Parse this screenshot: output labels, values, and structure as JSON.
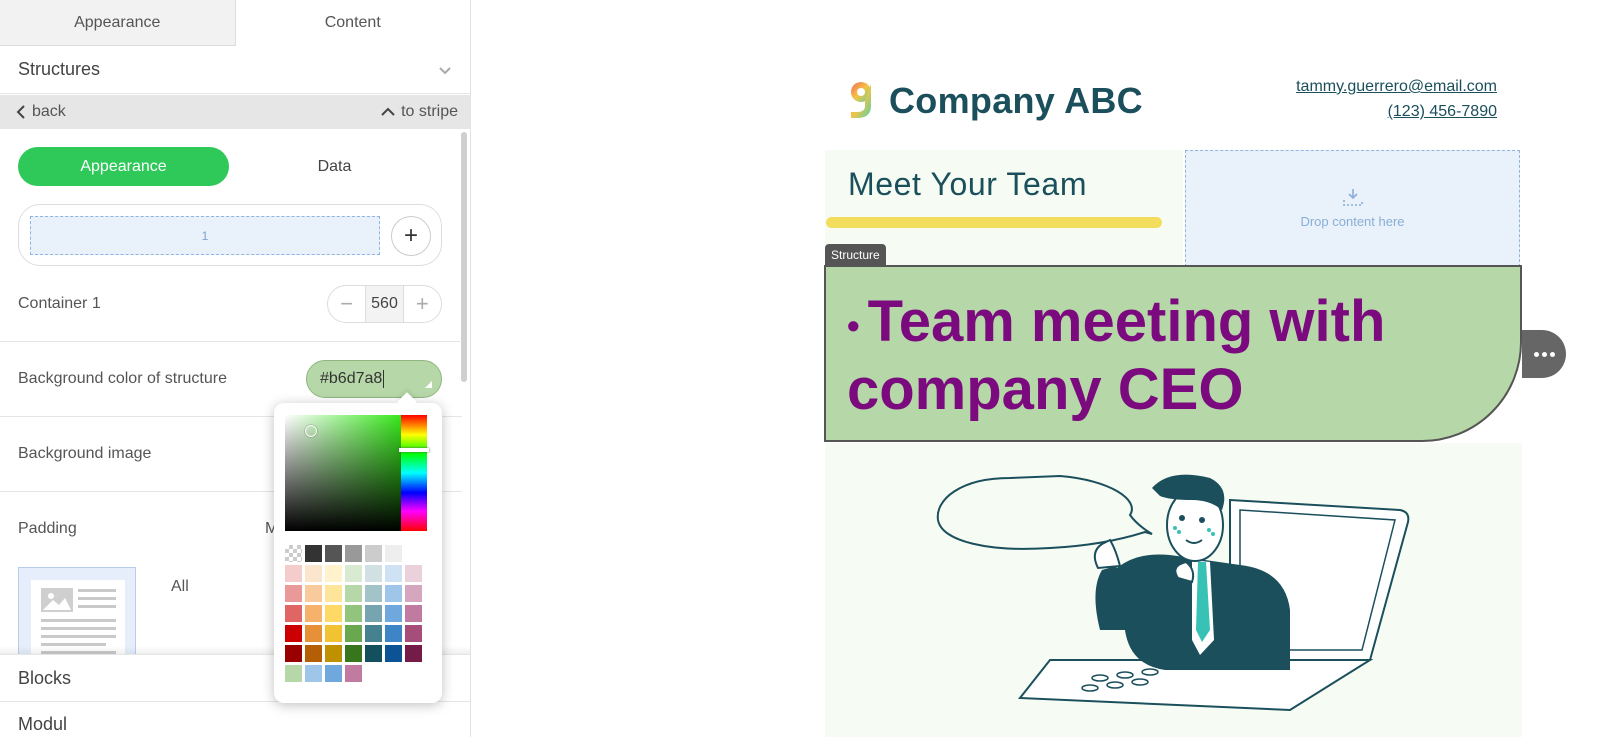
{
  "panel": {
    "tabs": [
      "Appearance",
      "Content"
    ],
    "structures_label": "Structures",
    "back_label": "back",
    "to_stripe_label": "to stripe",
    "segments": [
      "Appearance",
      "Data"
    ],
    "container_slot_label": "1",
    "add_symbol": "+",
    "container_label": "Container 1",
    "container_width": "560",
    "minus_symbol": "−",
    "plus_symbol": "+",
    "bg_color_label": "Background color of structure",
    "bg_color_value": "#b6d7a8",
    "bg_image_label": "Background image",
    "padding_label": "Padding",
    "padding_partial": "M",
    "padding_all_label": "All",
    "blocks_label": "Blocks",
    "modules_label": "Modul"
  },
  "picker": {
    "swatches": [
      "checker",
      "#333333",
      "#555555",
      "#999999",
      "#cccccc",
      "#eeeeee",
      "#ffffff",
      "#f4cccc",
      "#fce5cd",
      "#fff2cc",
      "#d9ead3",
      "#d0e0e3",
      "#cfe2f3",
      "#ead1dc",
      "#ea9999",
      "#f9cb9c",
      "#ffe599",
      "#b6d7a8",
      "#a2c4c9",
      "#9fc5e8",
      "#d5a6bd",
      "#e06666",
      "#f6b26b",
      "#ffd966",
      "#93c47d",
      "#76a5af",
      "#6fa8dc",
      "#c27ba0",
      "#cc0000",
      "#e69138",
      "#f1c232",
      "#6aa84f",
      "#45818e",
      "#3d85c6",
      "#a64d79",
      "#990000",
      "#b45f06",
      "#bf9000",
      "#38761d",
      "#134f5c",
      "#0b5394",
      "#741b47",
      "#b6d7a8",
      "#9fc5e8",
      "#6fa8dc",
      "#c27ba0"
    ]
  },
  "email": {
    "company": "Company ABC",
    "email": "tammy.guerrero@email.com",
    "phone": "(123) 456-7890",
    "team_title": "Meet Your Team",
    "drop_label": "Drop content here",
    "structure_tag": "Structure",
    "bullet": "•",
    "headline": "Team meeting with company CEO"
  },
  "colors": {
    "accent_green": "#2fc95a",
    "structure_bg": "#b6d7a8",
    "headline": "#7b0a7e",
    "brand_dark": "#1b4f5c"
  }
}
